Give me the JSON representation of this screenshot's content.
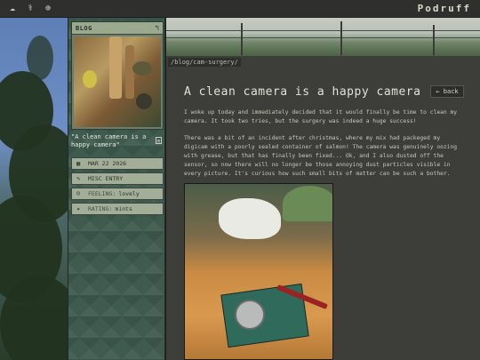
{
  "topbar": {
    "icons": [
      "cloud-icon",
      "tooth-icon",
      "target-icon"
    ],
    "brand": "Podruff"
  },
  "sidebar": {
    "card_label": "BLOG",
    "caption": "\"A clean camera is a happy camera\"",
    "meta": [
      {
        "icon": "calendar-icon",
        "key": "",
        "value": "MAR 22 2026"
      },
      {
        "icon": "pencil-icon",
        "key": "",
        "value": "MISC ENTRY"
      },
      {
        "icon": "person-icon",
        "key": "FEELING:",
        "value": "lovely"
      },
      {
        "icon": "star-icon",
        "key": "RATING:",
        "value": "mints"
      }
    ]
  },
  "main": {
    "path": "/blog/cam-surgery/",
    "title": "A clean camera is a happy camera",
    "back_label": "← back",
    "paragraph1": "I woke up today and immediately decided that it would finally be time to clean my camera. It took two tries, but the surgery was indeed a huge success!",
    "paragraph2": "There was a bit of an incident after christmas, where my mix had packeged my digicam with a poorly sealed container of salmon! The camera was genuinely oozing with grease, but that has finally been fixed... Ok, and I also dusted off the sensor, so now there will no longer be those annoying dust particles visible in every picture. It's curious how such small bits of matter can be such a bother."
  },
  "colors": {
    "sidebar_bg": "#3f5a4f",
    "main_bg": "#3d3d3a",
    "topbar_bg": "#2f302d"
  }
}
